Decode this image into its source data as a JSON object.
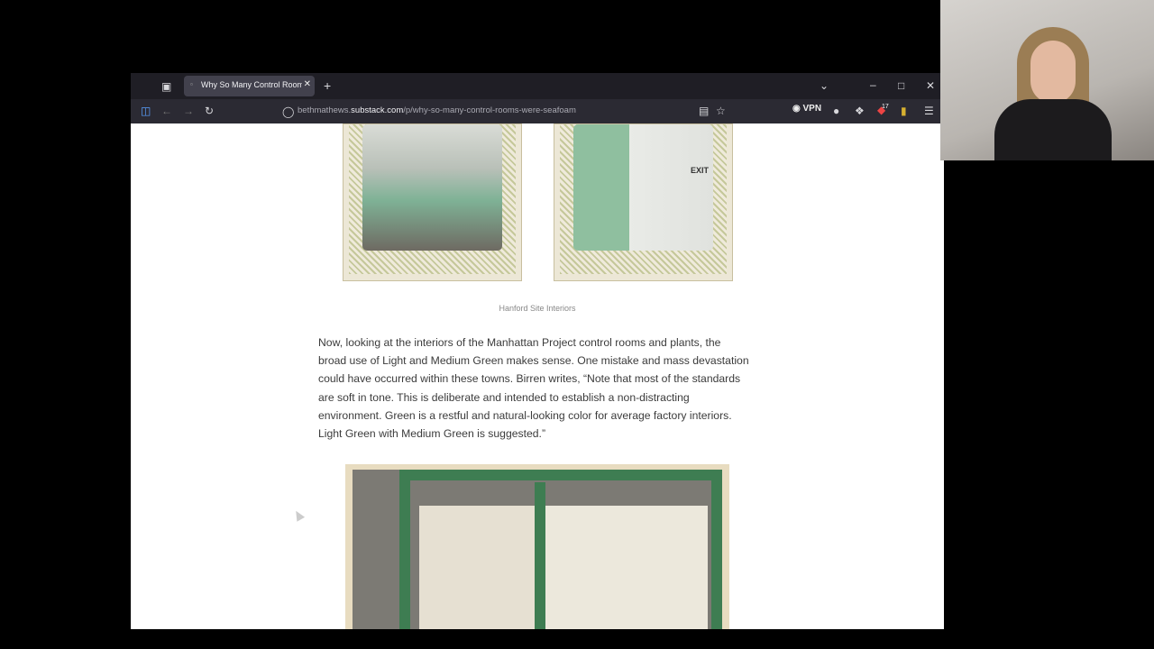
{
  "tab": {
    "title": "Why So Many Control Rooms W",
    "favicon": "substack-icon"
  },
  "address": {
    "prefix": "bethmathews.",
    "domain": "substack.com",
    "path": "/p/why-so-many-control-rooms-were-seafoam"
  },
  "toolbar": {
    "vpn_label": "VPN",
    "extension_badge": "17"
  },
  "article": {
    "caption": "Hanford Site Interiors",
    "paragraph": "Now, looking at the interiors of the Manhattan Project control rooms and plants, the broad use of Light and Medium Green makes sense. One mistake and mass devastation could have occurred within these towns. Birren writes, “Note that most of the standards are soft in tone. This is deliberate and intended to establish a non-distracting environment. Green is a restful and natural-looking color for average factory interiors. Light Green with Medium Green is suggested.”",
    "photo_exit_sign": "EXIT"
  },
  "colors": {
    "tab_bar": "#1f1e25",
    "nav_bar": "#2b2a33",
    "seafoam": "#8fbf9f",
    "frame_green": "#3e7d52"
  }
}
